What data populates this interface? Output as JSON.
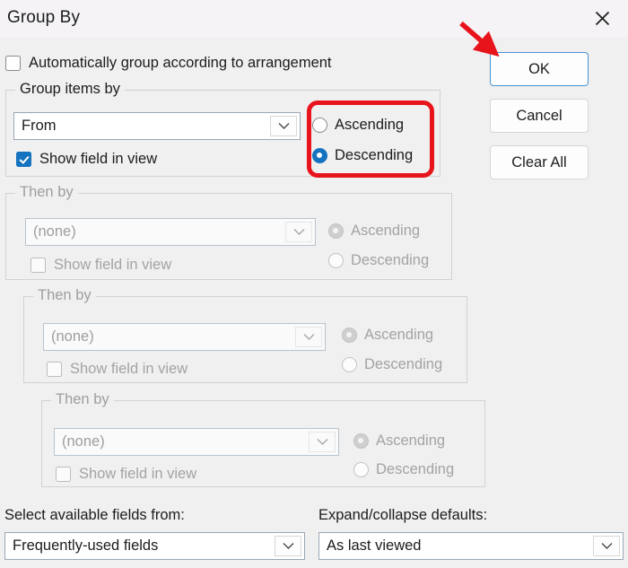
{
  "window": {
    "title": "Group By",
    "close_icon": "close-icon"
  },
  "auto_group": {
    "label": "Automatically group according to arrangement",
    "checked": false
  },
  "group_items_by": {
    "legend": "Group items by",
    "field_value": "From",
    "show_field_label": "Show field in view",
    "show_field_checked": true,
    "sort": {
      "ascending_label": "Ascending",
      "descending_label": "Descending",
      "selected": "Descending"
    },
    "enabled": true
  },
  "then_by": [
    {
      "legend": "Then by",
      "field_value": "(none)",
      "show_field_label": "Show field in view",
      "show_field_checked": false,
      "sort": {
        "ascending_label": "Ascending",
        "descending_label": "Descending",
        "selected": "Ascending"
      },
      "enabled": false
    },
    {
      "legend": "Then by",
      "field_value": "(none)",
      "show_field_label": "Show field in view",
      "show_field_checked": false,
      "sort": {
        "ascending_label": "Ascending",
        "descending_label": "Descending",
        "selected": "Ascending"
      },
      "enabled": false
    },
    {
      "legend": "Then by",
      "field_value": "(none)",
      "show_field_label": "Show field in view",
      "show_field_checked": false,
      "sort": {
        "ascending_label": "Ascending",
        "descending_label": "Descending",
        "selected": "Ascending"
      },
      "enabled": false
    }
  ],
  "bottom": {
    "available_fields_label": "Select available fields from:",
    "available_fields_value": "Frequently-used fields",
    "expand_collapse_label": "Expand/collapse defaults:",
    "expand_collapse_value": "As last viewed"
  },
  "buttons": {
    "ok": "OK",
    "cancel": "Cancel",
    "clear_all": "Clear All"
  },
  "annotations": {
    "highlight_color": "#e8141c",
    "arrow_color": "#e8141c",
    "highlight_target": "group-items-by-sort-radios",
    "arrow_target": "ok-button"
  },
  "colors": {
    "accent": "#1673c0",
    "dialog_bg": "#f0f0f0",
    "titlebar_bg": "#f5f3f6"
  }
}
